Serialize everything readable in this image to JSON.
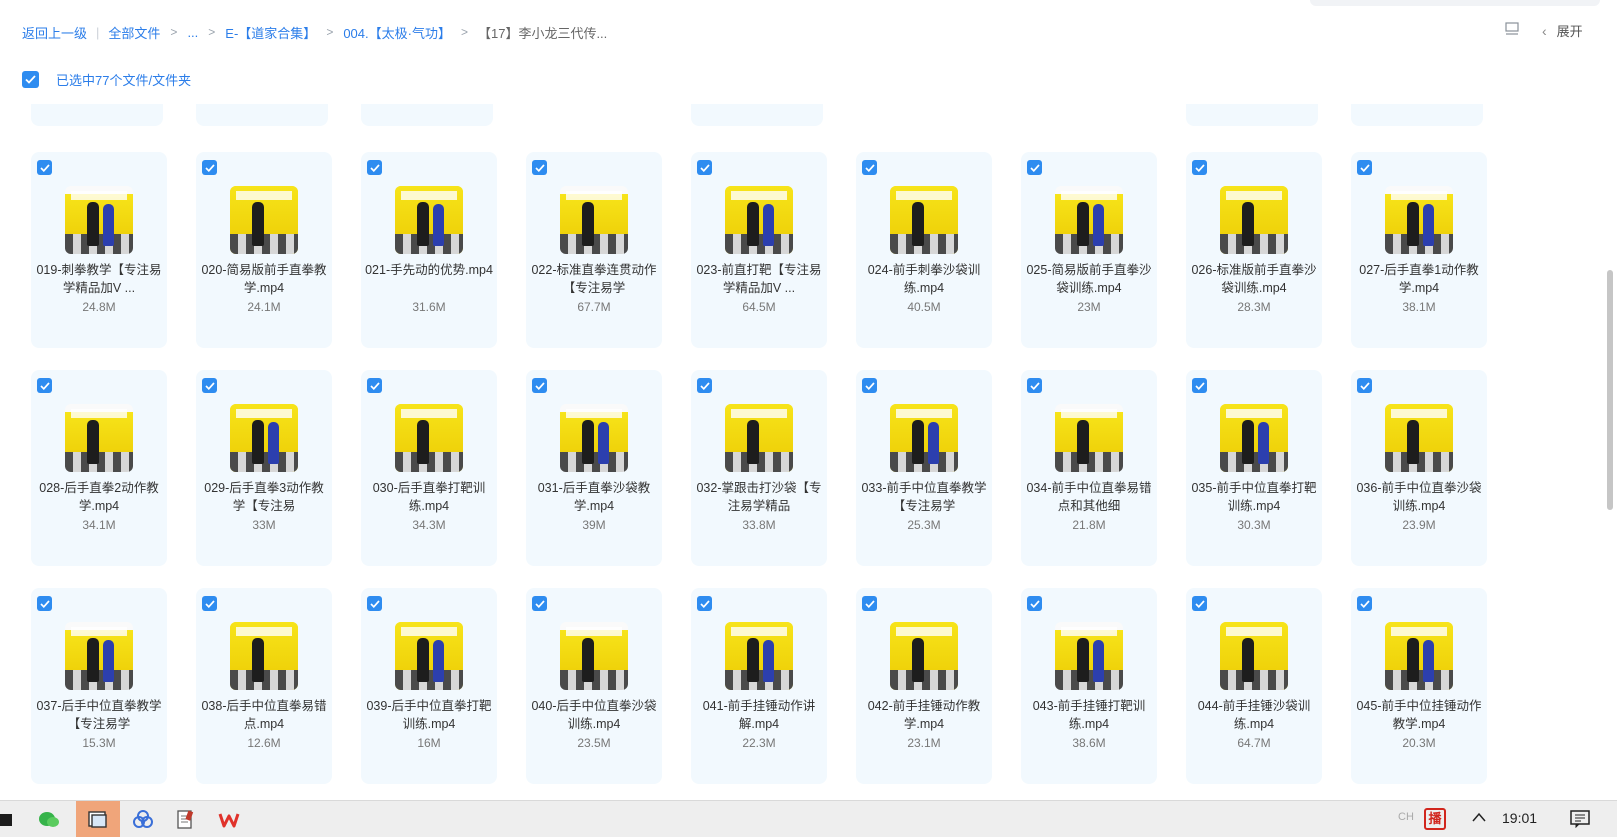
{
  "breadcrumb": {
    "back": "返回上一级",
    "all_files": "全部文件",
    "ellipsis": "...",
    "crumb1": "E-【道家合集】",
    "crumb2": "004.【太极·气功】",
    "current": "【17】李小龙三代传..."
  },
  "toolbar": {
    "expand_label": "展开"
  },
  "selection": {
    "label": "已选中77个文件/文件夹",
    "checked": true
  },
  "rows": [
    [
      {
        "name": "019-刺拳教学【专注易学精品加V ...",
        "size": "24.8M"
      },
      {
        "name": "020-简易版前手直拳教学.mp4",
        "size": "24.1M"
      },
      {
        "name": "021-手先动的优势.mp4",
        "size": "31.6M"
      },
      {
        "name": "022-标准直拳连贯动作【专注易学",
        "size": "67.7M"
      },
      {
        "name": "023-前直打靶【专注易学精品加V ...",
        "size": "64.5M"
      },
      {
        "name": "024-前手刺拳沙袋训练.mp4",
        "size": "40.5M"
      },
      {
        "name": "025-简易版前手直拳沙袋训练.mp4",
        "size": "23M"
      },
      {
        "name": "026-标准版前手直拳沙袋训练.mp4",
        "size": "28.3M"
      },
      {
        "name": "027-后手直拳1动作教学.mp4",
        "size": "38.1M"
      }
    ],
    [
      {
        "name": "028-后手直拳2动作教学.mp4",
        "size": "34.1M"
      },
      {
        "name": "029-后手直拳3动作教学【专注易",
        "size": "33M"
      },
      {
        "name": "030-后手直拳打靶训练.mp4",
        "size": "34.3M"
      },
      {
        "name": "031-后手直拳沙袋教学.mp4",
        "size": "39M"
      },
      {
        "name": "032-掌跟击打沙袋【专注易学精品",
        "size": "33.8M"
      },
      {
        "name": "033-前手中位直拳教学【专注易学",
        "size": "25.3M"
      },
      {
        "name": "034-前手中位直拳易错点和其他细",
        "size": "21.8M"
      },
      {
        "name": "035-前手中位直拳打靶训练.mp4",
        "size": "30.3M"
      },
      {
        "name": "036-前手中位直拳沙袋训练.mp4",
        "size": "23.9M"
      }
    ],
    [
      {
        "name": "037-后手中位直拳教学【专注易学",
        "size": "15.3M"
      },
      {
        "name": "038-后手中位直拳易错点.mp4",
        "size": "12.6M"
      },
      {
        "name": "039-后手中位直拳打靶训练.mp4",
        "size": "16M"
      },
      {
        "name": "040-后手中位直拳沙袋训练.mp4",
        "size": "23.5M"
      },
      {
        "name": "041-前手挂锤动作讲解.mp4",
        "size": "22.3M"
      },
      {
        "name": "042-前手挂锤动作教学.mp4",
        "size": "23.1M"
      },
      {
        "name": "043-前手挂锤打靶训练.mp4",
        "size": "38.6M"
      },
      {
        "name": "044-前手挂锤沙袋训练.mp4",
        "size": "64.7M"
      },
      {
        "name": "045-前手中位挂锤动作教学.mp4",
        "size": "20.3M"
      }
    ]
  ],
  "taskbar": {
    "time": "19:01",
    "input_method": "CH",
    "seal_char": "播",
    "apps": [
      "terminal-icon",
      "wechat-icon",
      "baidu-netdisk-icon",
      "cloud-app-icon",
      "notepad-icon",
      "wps-icon"
    ]
  },
  "colors": {
    "accent": "#2b7de9",
    "card_bg": "#f2f9fe",
    "checkbox": "#2e8cf0",
    "thumb_yellow": "#f5de10"
  }
}
